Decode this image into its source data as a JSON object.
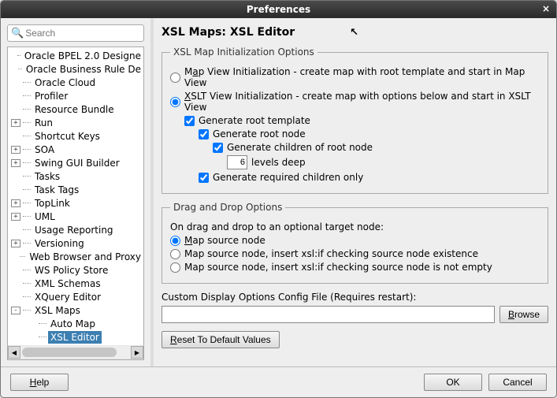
{
  "window_title": "Preferences",
  "search": {
    "placeholder": "Search"
  },
  "tree": {
    "items": [
      {
        "label": "Oracle BPEL 2.0 Designe",
        "depth": 1
      },
      {
        "label": "Oracle Business Rule De",
        "depth": 1
      },
      {
        "label": "Oracle Cloud",
        "depth": 1
      },
      {
        "label": "Profiler",
        "depth": 1
      },
      {
        "label": "Resource Bundle",
        "depth": 1
      },
      {
        "label": "Run",
        "depth": 1,
        "expand": "+"
      },
      {
        "label": "Shortcut Keys",
        "depth": 1
      },
      {
        "label": "SOA",
        "depth": 1,
        "expand": "+"
      },
      {
        "label": "Swing GUI Builder",
        "depth": 1,
        "expand": "+"
      },
      {
        "label": "Tasks",
        "depth": 1
      },
      {
        "label": "Task Tags",
        "depth": 1
      },
      {
        "label": "TopLink",
        "depth": 1,
        "expand": "+"
      },
      {
        "label": "UML",
        "depth": 1,
        "expand": "+"
      },
      {
        "label": "Usage Reporting",
        "depth": 1
      },
      {
        "label": "Versioning",
        "depth": 1,
        "expand": "+"
      },
      {
        "label": "Web Browser and Proxy",
        "depth": 1
      },
      {
        "label": "WS Policy Store",
        "depth": 1
      },
      {
        "label": "XML Schemas",
        "depth": 1
      },
      {
        "label": "XQuery Editor",
        "depth": 1
      },
      {
        "label": "XSL Maps",
        "depth": 1,
        "expand": "-"
      },
      {
        "label": "Auto Map",
        "depth": 2
      },
      {
        "label": "XSL Editor",
        "depth": 2,
        "selected": true
      }
    ]
  },
  "page": {
    "title": "XSL Maps: XSL Editor",
    "init_group": {
      "legend": "XSL Map Initialization Options",
      "map_view_label_pre": "M",
      "map_view_u": "a",
      "map_view_post": "p View Initialization - create map with root template and start in Map View",
      "xslt_view_pre": "",
      "xslt_view_u": "X",
      "xslt_view_post": "SLT View Initialization - create map with options below and start in XSLT View",
      "gen_root_template": "Generate root template",
      "gen_root_node": "Generate root node",
      "gen_children": "Generate children of root node",
      "levels_value": "6",
      "levels_label": "levels deep",
      "gen_required": "Generate required children only"
    },
    "dd_group": {
      "legend": "Drag and Drop Options",
      "intro": "On drag and drop to an optional target node:",
      "opt1_u": "M",
      "opt1_post": "ap source node",
      "opt2": "Map source node, insert xsl:if checking source node existence",
      "opt3": "Map source node, insert xsl:if checking source node is not empty"
    },
    "config_label": "Custom Display Options Config File (Requires restart):",
    "config_value": "",
    "browse_u": "B",
    "browse_post": "rowse",
    "reset_u": "R",
    "reset_post": "eset To Default Values"
  },
  "buttons": {
    "help_u": "H",
    "help_post": "elp",
    "ok": "OK",
    "cancel": "Cancel"
  }
}
